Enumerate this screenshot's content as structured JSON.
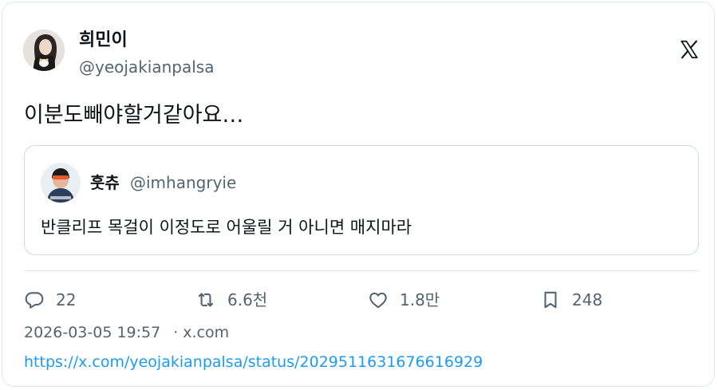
{
  "author": {
    "display_name": "희민이",
    "handle": "@yeojakianpalsa"
  },
  "tweet": {
    "text": "이분도빼야할거같아요…"
  },
  "quoted_tweet": {
    "display_name": "훗츄",
    "handle": "@imhangryie",
    "text": "반클리프 목걸이 이정도로 어울릴 거 아니면 매지마라"
  },
  "actions": {
    "reply_count": "22",
    "retweet_count": "6.6천",
    "like_count": "1.8만",
    "bookmark_count": "248"
  },
  "meta": {
    "timestamp": "2026-03-05 19:57",
    "separator": "·",
    "source": "x.com"
  },
  "url": "https://x.com/yeojakianpalsa/status/2029511631676616929",
  "colors": {
    "primary_text": "#0f1419",
    "secondary_text": "#536471",
    "link": "#1d9bf0",
    "border": "#cfd9de"
  },
  "icons": {
    "brand": "x-logo-icon",
    "reply": "reply-icon",
    "retweet": "retweet-icon",
    "like": "heart-icon",
    "bookmark": "bookmark-icon"
  }
}
